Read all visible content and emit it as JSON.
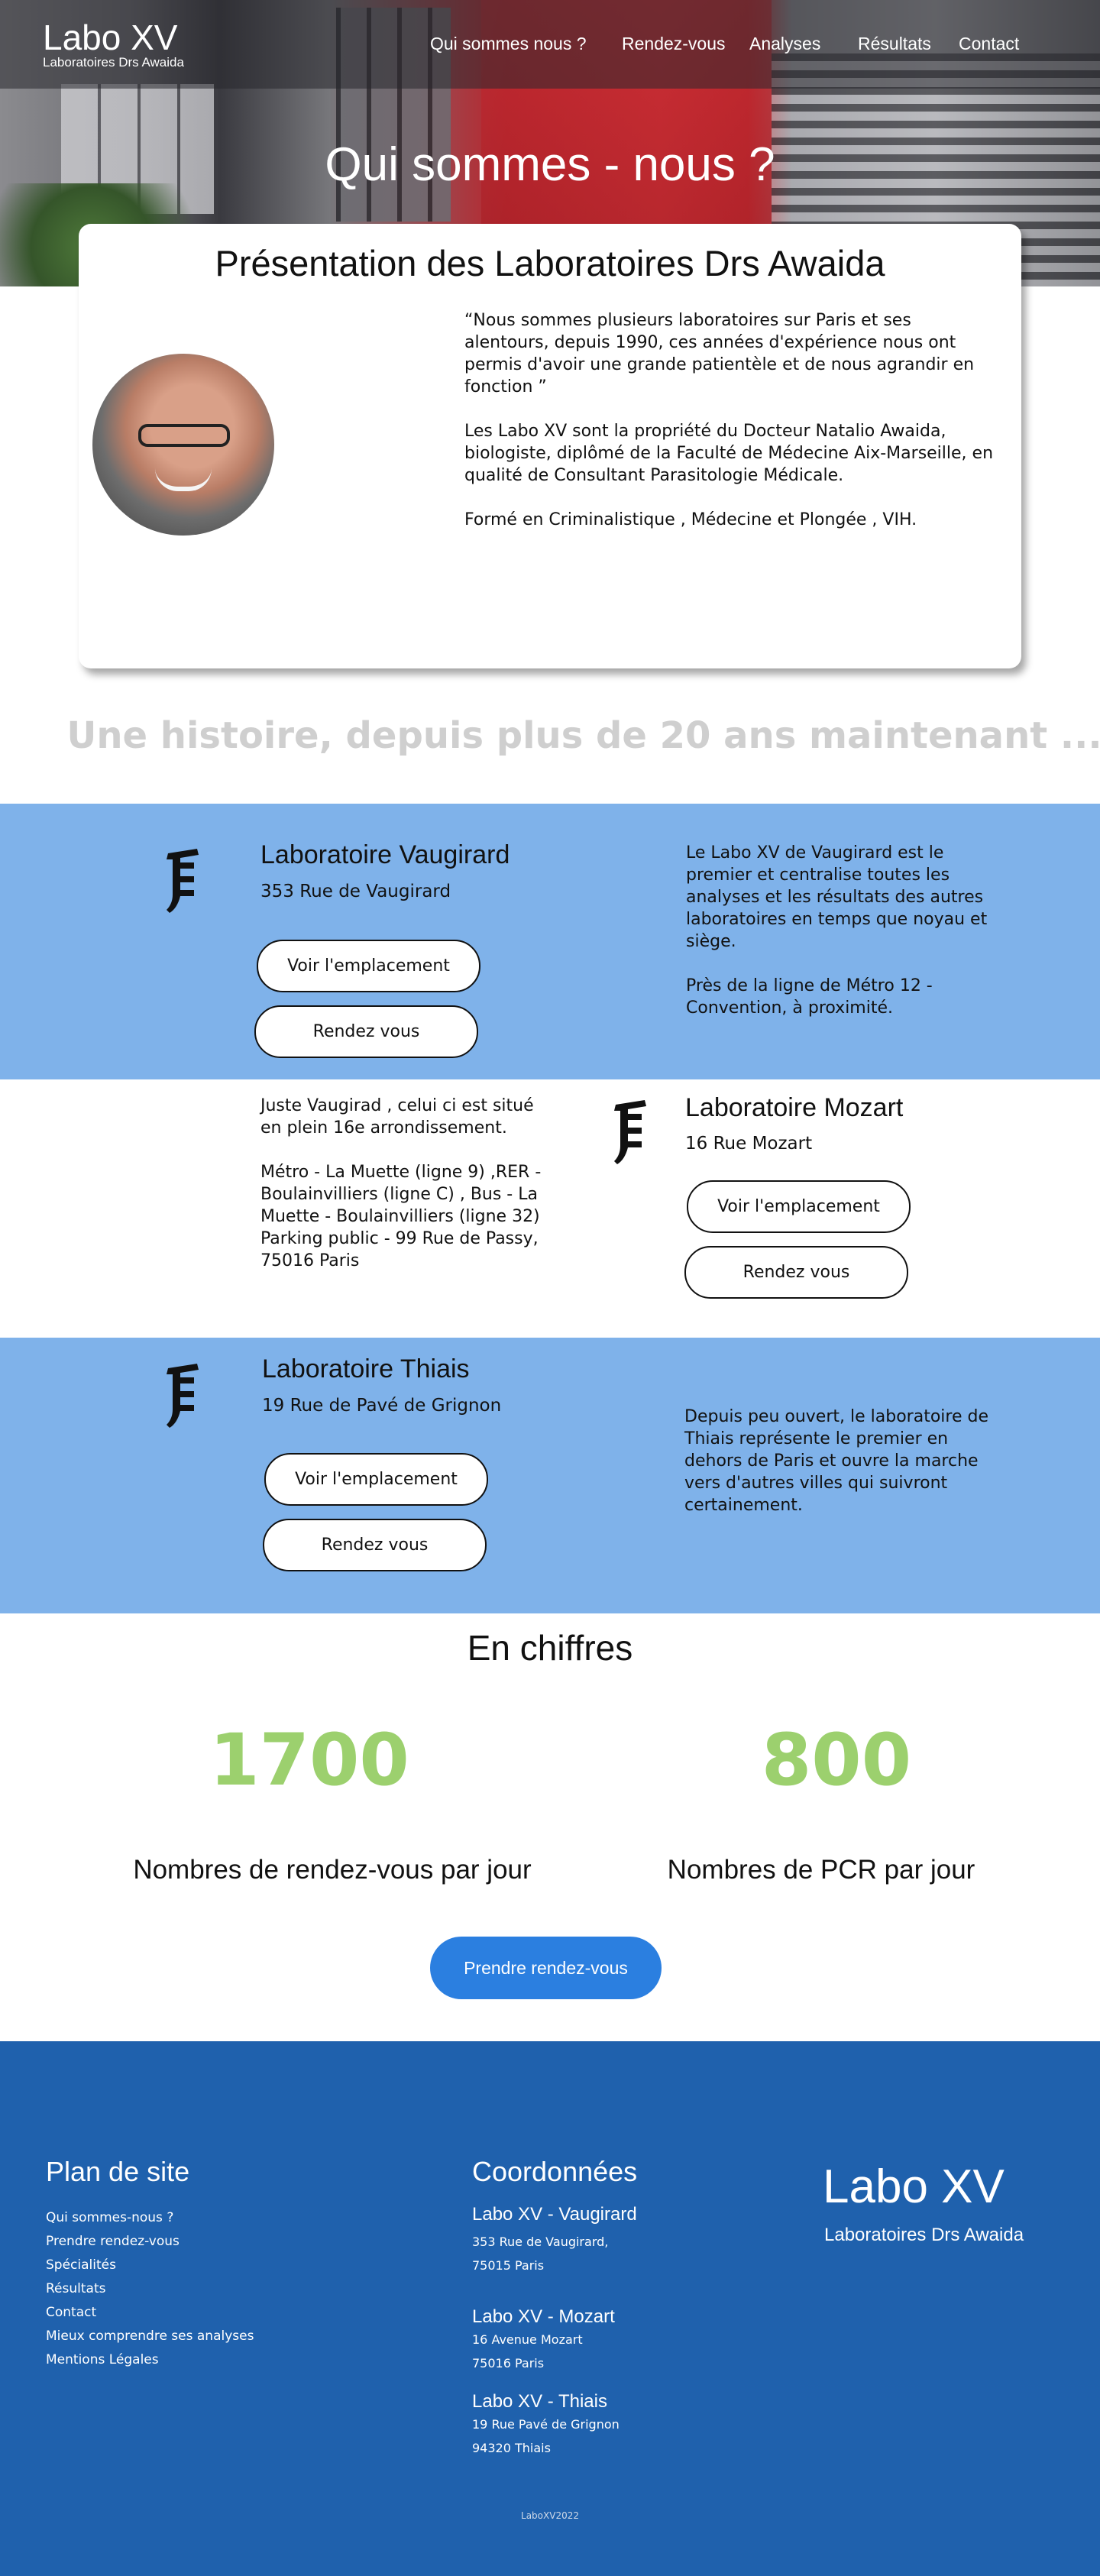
{
  "header": {
    "brand_title": "Labo XV",
    "brand_subtitle": "Laboratoires Drs Awaida",
    "nav": [
      "Qui sommes nous ?",
      "Rendez-vous",
      "Analyses",
      "Résultats",
      "Contact"
    ]
  },
  "hero": {
    "title": "Qui sommes - nous ?"
  },
  "presentation": {
    "title": "Présentation des Laboratoires Drs Awaida",
    "paragraphs": [
      "“Nous sommes plusieurs laboratoires sur Paris et ses alentours, depuis 1990, ces années d'expérience nous ont permis d'avoir une grande patientèle et de nous agrandir en fonction ”",
      "Les Labo XV sont la propriété du Docteur Natalio Awaida, biologiste, diplômé de la Faculté de Médecine Aix-Marseille, en qualité de Consultant Parasitologie Médicale.",
      "Formé en Criminalistique , Médecine et Plongée , VIH."
    ]
  },
  "history": {
    "text": "Une histoire, depuis plus de 20 ans maintenant ..."
  },
  "labs": [
    {
      "name": "Laboratoire Vaugirard",
      "address": "353 Rue de Vaugirard",
      "btn_location": "Voir l'emplacement",
      "btn_appointment": "Rendez vous",
      "desc": [
        "Le Labo XV de Vaugirard est le premier et centralise toutes les analyses et les  résultats des autres laboratoires en temps que noyau et siège.",
        "Près de la ligne de Métro 12  - Convention, à proximité."
      ]
    },
    {
      "name": "Laboratoire Mozart",
      "address": "16 Rue Mozart",
      "btn_location": "Voir l'emplacement",
      "btn_appointment": "Rendez vous",
      "desc": [
        "Juste Vaugirad , celui ci est situé en plein 16e arrondissement.",
        "Métro - La Muette (ligne 9) ,RER - Boulainvilliers (ligne C) , Bus - La Muette - Boulainvilliers (ligne 32)",
        "Parking public - 99 Rue de Passy, 75016 Paris"
      ]
    },
    {
      "name": "Laboratoire Thiais",
      "address": "19 Rue de Pavé de Grignon",
      "btn_location": "Voir l'emplacement",
      "btn_appointment": "Rendez vous",
      "desc": [
        "Depuis peu ouvert, le laboratoire de Thiais représente le premier en dehors de Paris et ouvre la marche vers d'autres villes qui suivront certainement."
      ]
    }
  ],
  "figures": {
    "title": "En chiffres",
    "stats": [
      {
        "value": "1700",
        "label": "Nombres de rendez-vous par jour"
      },
      {
        "value": "800",
        "label": "Nombres de PCR par jour"
      }
    ],
    "cta": "Prendre rendez-vous",
    "accent_color": "#9cd06e",
    "cta_color": "#2b7fe0"
  },
  "footer": {
    "sitemap_title": "Plan de site",
    "sitemap": [
      "Qui sommes-nous ?",
      "Prendre rendez-vous",
      "Spécialités",
      "Résultats",
      "Contact",
      "Mieux comprendre ses analyses",
      "Mentions Légales"
    ],
    "contact_title": "Coordonnées",
    "contacts": [
      {
        "name": "Labo XV - Vaugirard",
        "line1": "353 Rue de Vaugirard,",
        "line2": "75015 Paris"
      },
      {
        "name": "Labo XV - Mozart",
        "line1": "16 Avenue Mozart",
        "line2": "75016 Paris"
      },
      {
        "name": "Labo XV - Thiais",
        "line1": "19 Rue Pavé de Grignon",
        "line2": "94320 Thiais"
      }
    ],
    "brand_title": "Labo XV",
    "brand_subtitle": "Laboratoires Drs Awaida",
    "copyright": "LaboXV2022",
    "bg_color": "#1f61ad"
  },
  "icons": {
    "lab_icon": "microscope-icon"
  }
}
